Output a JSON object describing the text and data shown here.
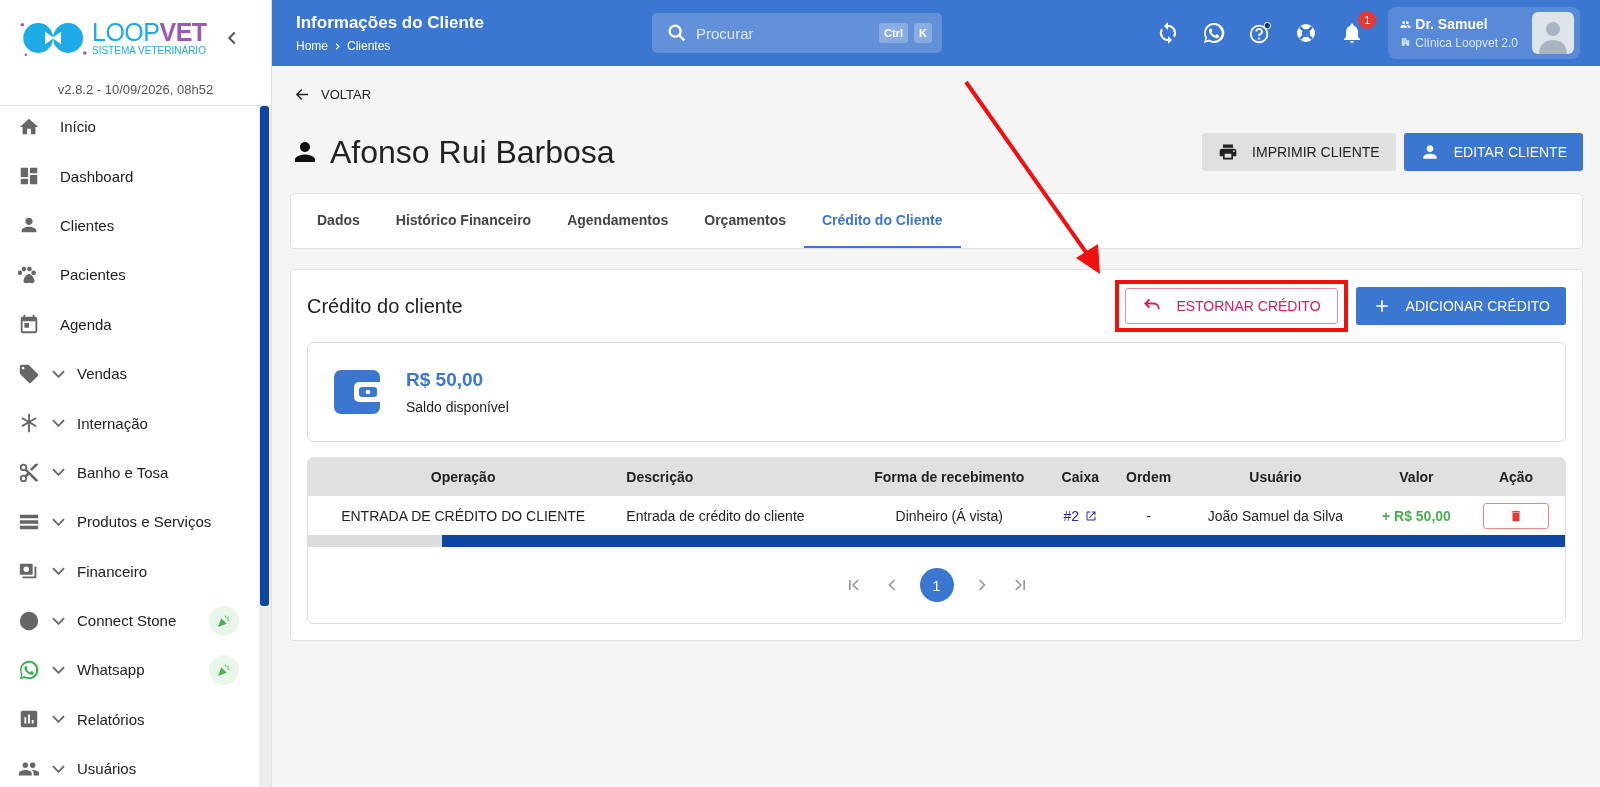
{
  "logo": {
    "brand_light": "LOOP",
    "brand_bold": "VET",
    "tagline": "SISTEMA VETERINÁRIO"
  },
  "version": "v2.8.2 - 10/09/2026, 08h52",
  "sidebar": {
    "items": [
      {
        "label": "Início",
        "expandable": false,
        "badge": false
      },
      {
        "label": "Dashboard",
        "expandable": false,
        "badge": false
      },
      {
        "label": "Clientes",
        "expandable": false,
        "badge": false
      },
      {
        "label": "Pacientes",
        "expandable": false,
        "badge": false
      },
      {
        "label": "Agenda",
        "expandable": false,
        "badge": false
      },
      {
        "label": "Vendas",
        "expandable": true,
        "badge": false
      },
      {
        "label": "Internação",
        "expandable": true,
        "badge": false
      },
      {
        "label": "Banho e Tosa",
        "expandable": true,
        "badge": false
      },
      {
        "label": "Produtos e Serviços",
        "expandable": true,
        "badge": false
      },
      {
        "label": "Financeiro",
        "expandable": true,
        "badge": false
      },
      {
        "label": "Connect Stone",
        "expandable": true,
        "badge": true
      },
      {
        "label": "Whatsapp",
        "expandable": true,
        "badge": true
      },
      {
        "label": "Relatórios",
        "expandable": true,
        "badge": false
      },
      {
        "label": "Usuários",
        "expandable": true,
        "badge": false
      }
    ]
  },
  "header": {
    "title": "Informações do Cliente",
    "breadcrumb": [
      "Home",
      "Clientes"
    ],
    "search": {
      "placeholder": "Procurar",
      "keys": [
        "Ctrl",
        "K"
      ]
    },
    "notifications": "1",
    "user": {
      "name": "Dr. Samuel",
      "clinic": "Clínica Loopvet 2.0"
    }
  },
  "back": "VOLTAR",
  "client_name": "Afonso Rui Barbosa",
  "actions": [
    "IMPRIMIR CLIENTE",
    "EDITAR CLIENTE"
  ],
  "tabs": [
    {
      "label": "Dados",
      "selected": false
    },
    {
      "label": "Histórico Financeiro",
      "selected": false
    },
    {
      "label": "Agendamentos",
      "selected": false
    },
    {
      "label": "Orçamentos",
      "selected": false
    },
    {
      "label": "Crédito do Cliente",
      "selected": true
    }
  ],
  "credit": {
    "title": "Crédito do cliente",
    "refund_button": "ESTORNAR CRÉDITO",
    "add_button": "ADICIONAR CRÉDITO",
    "balance": "R$ 50,00",
    "balance_label": "Saldo disponível"
  },
  "table": {
    "columns": [
      "Operação",
      "Descrição",
      "Forma de recebimento",
      "Caixa",
      "Ordem",
      "Usuário",
      "Valor",
      "Ação"
    ],
    "rows": [
      {
        "operacao": "ENTRADA DE CRÉDITO DO CLIENTE",
        "descricao": "Entrada de crédito do cliente",
        "forma": "Dinheiro (Á vista)",
        "caixa": "#2",
        "ordem": "-",
        "usuario": "João Samuel da Silva",
        "valor": "+ R$ 50,00"
      }
    ]
  },
  "pagination": {
    "pages": [
      {
        "label": "1",
        "selected": true
      }
    ]
  }
}
